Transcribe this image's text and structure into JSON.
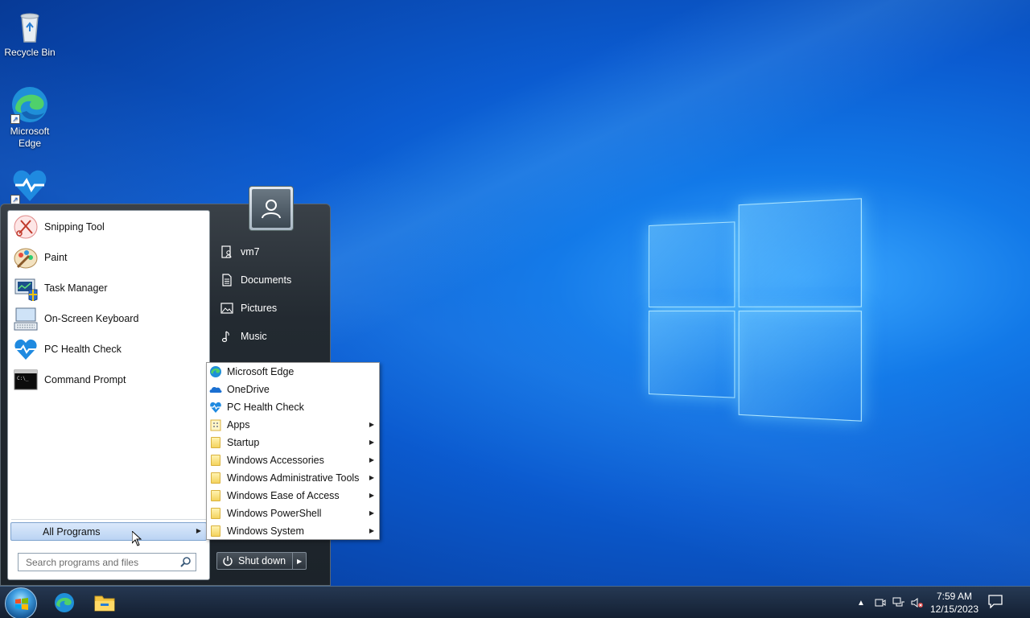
{
  "desktop": {
    "icons": [
      {
        "label": "Recycle Bin",
        "icon": "recycle-bin-icon"
      },
      {
        "label": "Microsoft\nEdge",
        "icon": "edge-icon"
      },
      {
        "label": "",
        "icon": "pc-health-check-icon"
      }
    ]
  },
  "start_menu": {
    "pinned": [
      {
        "label": "Snipping Tool",
        "icon": "snipping-tool-icon"
      },
      {
        "label": "Paint",
        "icon": "paint-icon"
      },
      {
        "label": "Task Manager",
        "icon": "task-manager-icon"
      },
      {
        "label": "On-Screen Keyboard",
        "icon": "keyboard-icon"
      },
      {
        "label": "PC Health Check",
        "icon": "pc-health-check-icon"
      },
      {
        "label": "Command Prompt",
        "icon": "command-prompt-icon"
      }
    ],
    "all_programs_label": "All Programs",
    "search_placeholder": "Search programs and files",
    "right_items": [
      {
        "label": "vm7",
        "icon": "user-folder-icon"
      },
      {
        "label": "Documents",
        "icon": "documents-icon"
      },
      {
        "label": "Pictures",
        "icon": "pictures-icon"
      },
      {
        "label": "Music",
        "icon": "music-icon"
      }
    ],
    "shutdown_label": "Shut down"
  },
  "submenu": {
    "items": [
      {
        "label": "Microsoft Edge",
        "icon": "edge-icon",
        "has_arrow": false
      },
      {
        "label": "OneDrive",
        "icon": "onedrive-icon",
        "has_arrow": false
      },
      {
        "label": "PC Health Check",
        "icon": "pc-health-check-icon",
        "has_arrow": false
      },
      {
        "label": "Apps",
        "icon": "apps-icon",
        "has_arrow": true
      },
      {
        "label": "Startup",
        "icon": "folder-icon",
        "has_arrow": true
      },
      {
        "label": "Windows Accessories",
        "icon": "folder-icon",
        "has_arrow": true
      },
      {
        "label": "Windows Administrative Tools",
        "icon": "folder-icon",
        "has_arrow": true
      },
      {
        "label": "Windows Ease of Access",
        "icon": "folder-icon",
        "has_arrow": true
      },
      {
        "label": "Windows PowerShell",
        "icon": "folder-icon",
        "has_arrow": true
      },
      {
        "label": "Windows System",
        "icon": "folder-icon",
        "has_arrow": true
      }
    ]
  },
  "taskbar": {
    "pinned": [
      {
        "icon": "edge-icon"
      },
      {
        "icon": "file-explorer-icon"
      }
    ],
    "clock": {
      "time": "7:59 AM",
      "date": "12/15/2023"
    }
  },
  "colors": {
    "accent": "#0b5bd0",
    "highlight": "#bad3f3"
  }
}
